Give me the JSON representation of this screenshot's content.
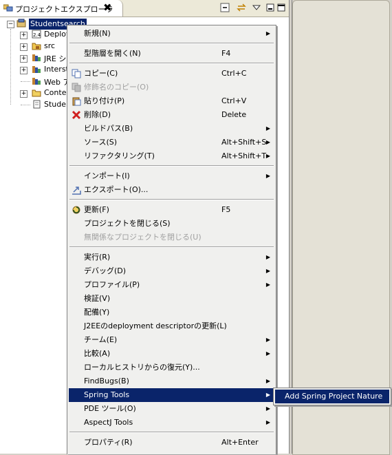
{
  "view": {
    "title": "プロジェクトエクスプローラ",
    "close_glyph": "✖",
    "toolbar": {
      "collapse_icon": "collapse-all-icon",
      "link_icon": "link-with-editor-icon",
      "menu_icon": "view-menu-icon",
      "minimize_icon": "minimize-icon",
      "maximize_icon": "maximize-icon"
    }
  },
  "tree": {
    "root": "Studentsearch",
    "items": [
      {
        "label": "Deploy",
        "icon": "deployment-descriptor-icon"
      },
      {
        "label": "src",
        "icon": "source-folder-icon"
      },
      {
        "label": "JRE シ",
        "icon": "library-icon"
      },
      {
        "label": "Interst",
        "icon": "library-icon"
      },
      {
        "label": "Web ア",
        "icon": "library-icon"
      },
      {
        "label": "Conte",
        "icon": "folder-icon"
      },
      {
        "label": "Studer",
        "icon": "file-icon"
      }
    ]
  },
  "menu": {
    "items": [
      {
        "label": "新規(N)",
        "accel": "",
        "submenu": true
      },
      {
        "label": "型階層を開く(N)",
        "accel": "F4"
      },
      {
        "label": "コピー(C)",
        "accel": "Ctrl+C",
        "icon": "copy-icon"
      },
      {
        "label": "修飾名のコピー(O)",
        "accel": "",
        "icon": "copy-qualified-icon",
        "disabled": true
      },
      {
        "label": "貼り付け(P)",
        "accel": "Ctrl+V",
        "icon": "paste-icon"
      },
      {
        "label": "削除(D)",
        "accel": "Delete",
        "icon": "delete-icon"
      },
      {
        "label": "ビルドパス(B)",
        "accel": "",
        "submenu": true
      },
      {
        "label": "ソース(S)",
        "accel": "Alt+Shift+S",
        "submenu": true
      },
      {
        "label": "リファクタリング(T)",
        "accel": "Alt+Shift+T",
        "submenu": true
      },
      {
        "label": "インポート(I)",
        "accel": "",
        "submenu": true
      },
      {
        "label": "エクスポート(O)...",
        "accel": "",
        "icon": "export-icon"
      },
      {
        "label": "更新(F)",
        "accel": "F5",
        "icon": "refresh-icon"
      },
      {
        "label": "プロジェクトを閉じる(S)",
        "accel": ""
      },
      {
        "label": "無関係なプロジェクトを閉じる(U)",
        "accel": "",
        "disabled": true
      },
      {
        "label": "実行(R)",
        "accel": "",
        "submenu": true
      },
      {
        "label": "デバッグ(D)",
        "accel": "",
        "submenu": true
      },
      {
        "label": "プロファイル(P)",
        "accel": "",
        "submenu": true
      },
      {
        "label": "検証(V)",
        "accel": ""
      },
      {
        "label": "配備(Y)",
        "accel": ""
      },
      {
        "label": "J2EEのdeployment descriptorの更新(L)",
        "accel": ""
      },
      {
        "label": "チーム(E)",
        "accel": "",
        "submenu": true
      },
      {
        "label": "比較(A)",
        "accel": "",
        "submenu": true
      },
      {
        "label": "ローカルヒストリからの復元(Y)...",
        "accel": ""
      },
      {
        "label": "FindBugs(B)",
        "accel": "",
        "submenu": true
      },
      {
        "label": "Spring Tools",
        "accel": "",
        "submenu": true,
        "selected": true
      },
      {
        "label": "PDE ツール(O)",
        "accel": "",
        "submenu": true
      },
      {
        "label": "AspectJ Tools",
        "accel": "",
        "submenu": true
      },
      {
        "label": "プロパティ(R)",
        "accel": "Alt+Enter"
      }
    ]
  },
  "submenu": {
    "label": "Add Spring Project Nature"
  },
  "colors": {
    "selection": "#0a246a",
    "menu_bg": "#f0f0ee"
  }
}
